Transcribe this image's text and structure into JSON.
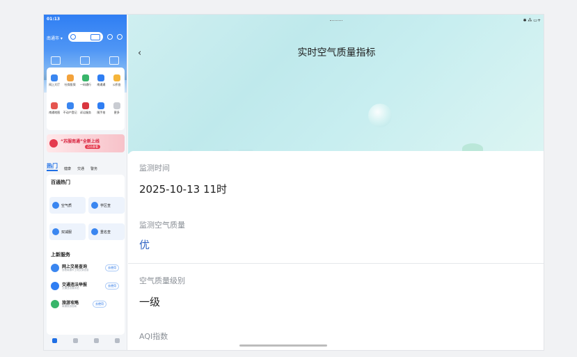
{
  "left": {
    "status_time": "01:13",
    "city": "南通市 ▾",
    "services_row1": [
      "网上大厅",
      "社保医保",
      "一码通行",
      "南通通",
      "公积金"
    ],
    "services_row2": [
      "南通地图",
      "不动产登记",
      "诉讼服务",
      "随手拍",
      "更多"
    ],
    "banner_title": "“苏服南通”全新上线",
    "banner_sub": "点击查看",
    "category_tabs": [
      "热门",
      "健康",
      "交通",
      "警务"
    ],
    "hot_title": "百通热门",
    "hot_tiles": [
      "空气质",
      "学区查",
      "双减服",
      "重名查"
    ],
    "new_title": "上新服务",
    "new_items": [
      {
        "name": "网上交易查询",
        "desc": "查看南通市土地交易信息",
        "action": "去使用"
      },
      {
        "name": "交通违法举报",
        "desc": "交通违法随手拍",
        "action": "去使用"
      },
      {
        "name": "旅游攻略",
        "desc": "南通旅游指南",
        "action": "去使用"
      }
    ],
    "bottom_nav": [
      "首页",
      "服务",
      "生活",
      "我的"
    ]
  },
  "right": {
    "status_right": "✱ ⁂ ▭+",
    "back": "‹",
    "title": "实时空气质量指标",
    "faded_banner": "空气质量",
    "fields": [
      {
        "label": "监测时间",
        "value": "2025-10-13 11时"
      },
      {
        "label": "监测空气质量",
        "value": "优"
      },
      {
        "label": "空气质量级别",
        "value": "一级"
      },
      {
        "label": "AQI指数",
        "value": ""
      }
    ]
  },
  "colors": {
    "brand_blue": "#1f6fe5",
    "value_blue": "#2f63c4",
    "hero_teal": "#c8eef0"
  }
}
